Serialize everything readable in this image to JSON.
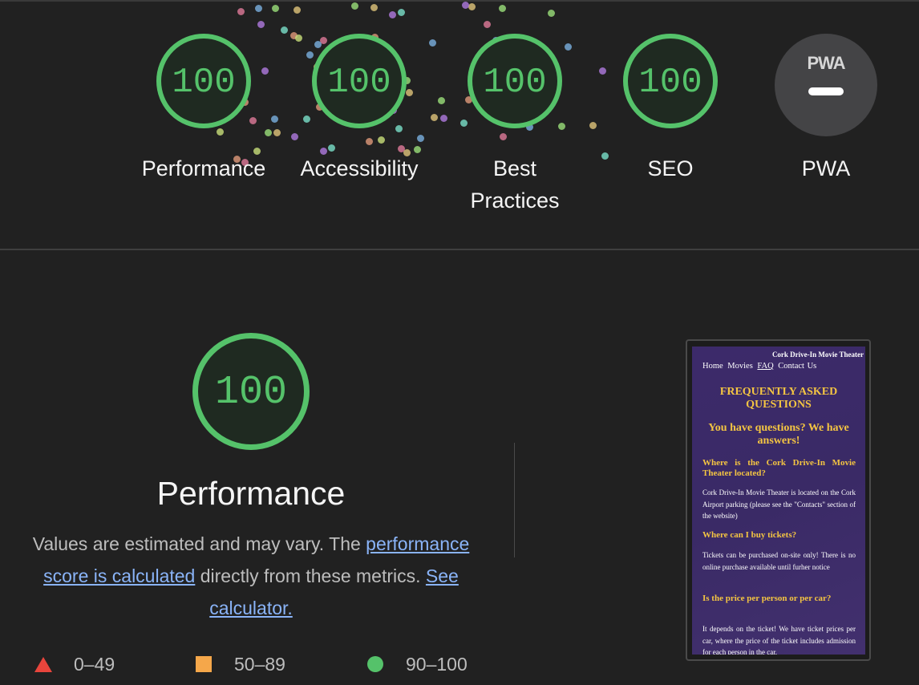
{
  "categories": [
    {
      "label": "Performance",
      "score": "100"
    },
    {
      "label": "Accessibility",
      "score": "100"
    },
    {
      "label": "Best Practices",
      "score": "100"
    },
    {
      "label": "SEO",
      "score": "100"
    }
  ],
  "pwa": {
    "logo": "PWA",
    "label": "PWA"
  },
  "performance_section": {
    "score": "100",
    "title": "Performance",
    "desc_prefix": "Values are estimated and may vary. The ",
    "link_score": "performance score is calculated",
    "desc_middle": " directly from these metrics. ",
    "link_calculator": "See calculator."
  },
  "legend": [
    {
      "range": "0–49",
      "color": "#e8453c"
    },
    {
      "range": "50–89",
      "color": "#f5a74a"
    },
    {
      "range": "90–100",
      "color": "#55c26a"
    }
  ],
  "screenshot": {
    "brand": "Cork Drive-In Movie Theater",
    "nav": [
      "Home",
      "Movies",
      "FAQ",
      "Contact Us"
    ],
    "heading": "FREQUENTLY ASKED QUESTIONS",
    "subheading": "You have questions? We have answers!",
    "faq": [
      {
        "q": "Where is the Cork Drive-In Movie Theater located?",
        "a": "Cork Drive-In Movie Theater is located on the Cork Airport parking (please see the \"Contacts\" section of the website)"
      },
      {
        "q": "Where can I buy tickets?",
        "a": "Tickets can be purchased on-site only! There is no online purchase available until furher notice"
      },
      {
        "q": "Is the price per person or per car?",
        "a": "It depends on the ticket! We have ticket prices per car, where the price of the ticket includes admission for each person in the car."
      }
    ]
  },
  "colors": {
    "pass": "#55c26a",
    "average": "#f5a74a",
    "fail": "#e8453c",
    "background": "#212121"
  }
}
